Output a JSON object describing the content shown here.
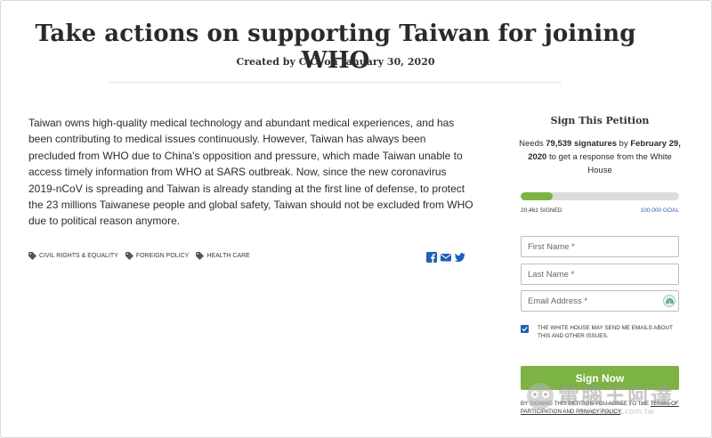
{
  "petition": {
    "title": "Take actions on supporting Taiwan for joining WHO",
    "byline": "Created by C.C. on January 30, 2020",
    "body": "Taiwan owns high-quality medical technology and abundant medical experiences, and has been contributing to medical issues continuously. However, Taiwan has always been precluded from WHO due to China's opposition and pressure, which made Taiwan unable to access timely information from WHO at SARS outbreak. Now, since the new coronavirus 2019-nCoV is spreading and Taiwan is already standing at the first line of defense, to protect the 23 millions Taiwanese people and global safety, Taiwan should not be excluded from WHO due to political reason anymore.",
    "tags": [
      {
        "label": "CIVIL RIGHTS & EQUALITY",
        "icon": "tag-icon"
      },
      {
        "label": "FOREIGN POLICY",
        "icon": "tag-icon"
      },
      {
        "label": "HEALTH CARE",
        "icon": "tag-icon"
      }
    ],
    "share_icons": [
      "facebook-icon",
      "email-icon",
      "twitter-icon"
    ]
  },
  "sign": {
    "heading": "Sign This Petition",
    "needs_prefix": "Needs",
    "needs_count": "79,539 signatures",
    "needs_mid": "by",
    "needs_deadline": "February 29, 2020",
    "needs_suffix": "to get a response from the White House",
    "progress_fraction": 0.2046,
    "signed_label": "20,461 SIGNED",
    "goal_label": "100,000 GOAL",
    "first_name_placeholder": "First Name *",
    "last_name_placeholder": "Last Name *",
    "email_placeholder": "Email Address *",
    "consent_checked": true,
    "consent_text": "THE WHITE HOUSE MAY SEND ME EMAILS ABOUT THIS AND OTHER ISSUES.",
    "submit_label": "Sign Now",
    "fine_print_prefix": "BY SIGNING THIS PETITION YOU AGREE TO THE",
    "fine_print_link": "TERMS OF PARTICIPATION AND PRIVACY POLICY",
    "fine_print_suffix": "."
  },
  "watermark": {
    "text": "電腦王阿達",
    "url": "www.kocpc.com.tw"
  },
  "colors": {
    "accent_green": "#7cb342",
    "link_blue": "#2a5db0",
    "checkbox_blue": "#1f5fb7",
    "share_blue": "#1f5fb7"
  }
}
